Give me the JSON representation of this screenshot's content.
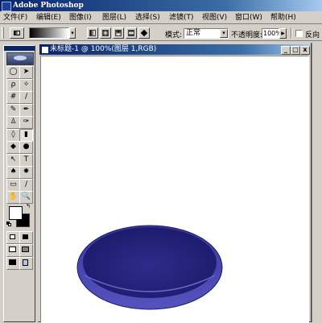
{
  "app": {
    "title": "Adobe Photoshop"
  },
  "menu": [
    "文件(F)",
    "编辑(E)",
    "图像(I)",
    "图层(L)",
    "选择(S)",
    "滤镜(T)",
    "视图(V)",
    "窗口(W)",
    "帮助(H)"
  ],
  "options": {
    "mode_label": "模式:",
    "mode_value": "正常",
    "opacity_label": "不透明度:",
    "opacity_value": "100%",
    "opacity_arrow": "▶",
    "reverse_label": "反向",
    "reverse_checked": false
  },
  "document": {
    "title": "未标题-1 @ 100%(图层 1,RGB)",
    "minimize_glyph": "_",
    "maximize_glyph": "□",
    "close_glyph": "x"
  },
  "tools": [
    {
      "name": "marquee-tool",
      "glyph": "◯"
    },
    {
      "name": "move-tool",
      "glyph": "➤"
    },
    {
      "name": "lasso-tool",
      "glyph": "ρ"
    },
    {
      "name": "magic-wand-tool",
      "glyph": "✧"
    },
    {
      "name": "crop-tool",
      "glyph": "#"
    },
    {
      "name": "slice-tool",
      "glyph": "∕"
    },
    {
      "name": "healing-brush-tool",
      "glyph": "✎"
    },
    {
      "name": "brush-tool",
      "glyph": "✒"
    },
    {
      "name": "clone-stamp-tool",
      "glyph": "♙"
    },
    {
      "name": "history-brush-tool",
      "glyph": "✑"
    },
    {
      "name": "eraser-tool",
      "glyph": "◊"
    },
    {
      "name": "gradient-tool",
      "glyph": "▮"
    },
    {
      "name": "blur-tool",
      "glyph": "◆"
    },
    {
      "name": "dodge-tool",
      "glyph": "●"
    },
    {
      "name": "path-selection-tool",
      "glyph": "↖"
    },
    {
      "name": "type-tool",
      "glyph": "T"
    },
    {
      "name": "pen-tool",
      "glyph": "♠"
    },
    {
      "name": "custom-shape-tool",
      "glyph": "✸"
    },
    {
      "name": "notes-tool",
      "glyph": "▭"
    },
    {
      "name": "eyedropper-tool",
      "glyph": "∕"
    },
    {
      "name": "hand-tool",
      "glyph": "✋"
    },
    {
      "name": "zoom-tool",
      "glyph": "🔍"
    }
  ],
  "colors": {
    "title_bar_start": "#0a246a",
    "title_bar_end": "#a6caf0",
    "chrome": "#d4d0c8",
    "ellipse_fill": "#2b2a85",
    "ellipse_rim": "#4a48b0",
    "foreground": "#000000",
    "background": "#ffffff"
  }
}
